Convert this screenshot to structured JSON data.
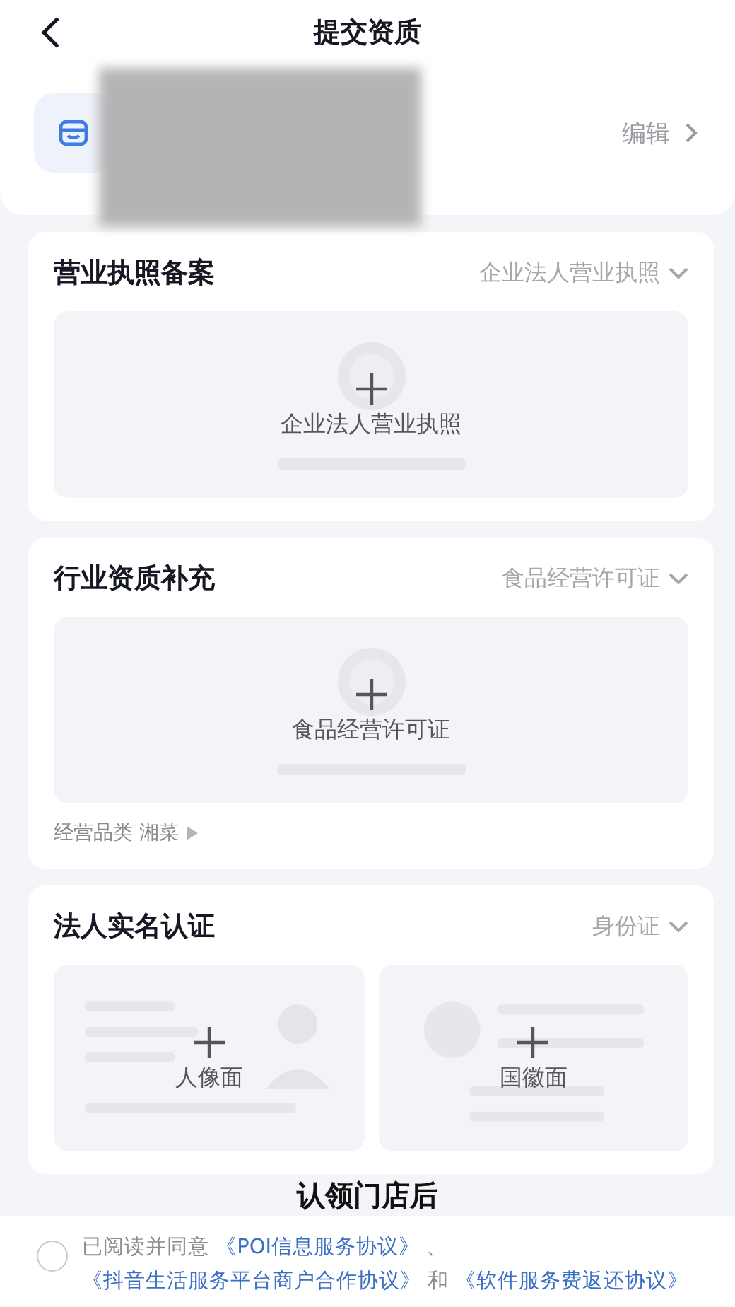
{
  "nav": {
    "title": "提交资质"
  },
  "store": {
    "action": "编辑"
  },
  "sections": [
    {
      "title": "营业执照备案",
      "selector": "企业法人营业执照",
      "uploads": [
        {
          "kind": "document",
          "label": "企业法人营业执照"
        }
      ]
    },
    {
      "title": "行业资质补充",
      "selector": "食品经营许可证",
      "uploads": [
        {
          "kind": "document",
          "label": "食品经营许可证"
        }
      ],
      "note": "经营品类 湘菜"
    },
    {
      "title": "法人实名认证",
      "selector": "身份证",
      "uploads": [
        {
          "kind": "portrait",
          "label": "人像面"
        },
        {
          "kind": "emblem",
          "label": "国徽面"
        }
      ]
    }
  ],
  "caption": "认领门店后",
  "agreement": {
    "checked": false,
    "parts": [
      {
        "kind": "text",
        "text": "已阅读并同意"
      },
      {
        "kind": "link",
        "text": "《POI信息服务协议》"
      },
      {
        "kind": "text",
        "text": "、"
      },
      {
        "kind": "link",
        "text": "《抖音生活服务平台商户合作协议》"
      },
      {
        "kind": "text",
        "text": "和"
      },
      {
        "kind": "link",
        "text": "《软件服务费返还协议》"
      }
    ]
  }
}
